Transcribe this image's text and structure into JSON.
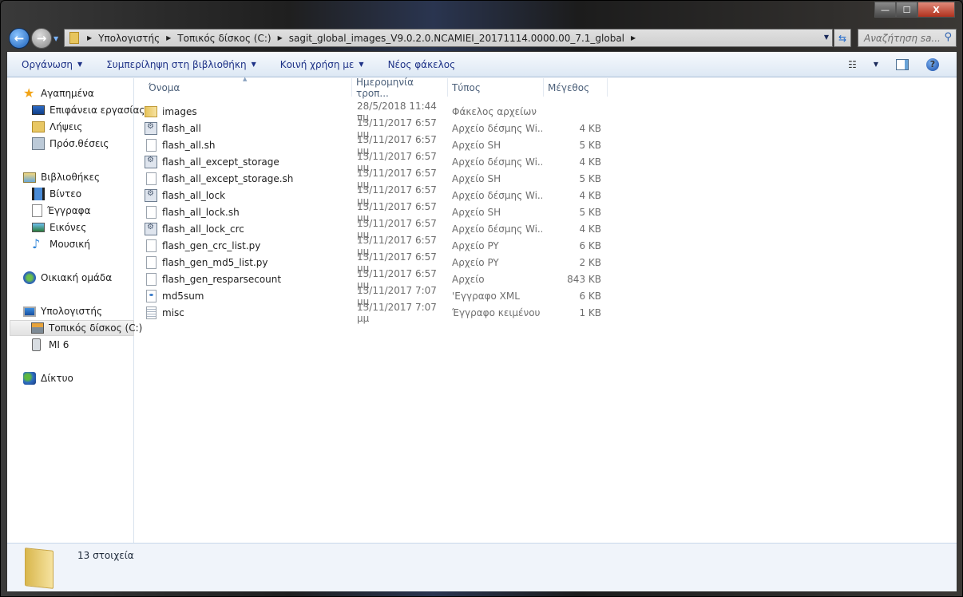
{
  "window": {
    "minimize": "—",
    "maximize": "☐",
    "close": "X"
  },
  "address": {
    "crumbs": [
      "Υπολογιστής",
      "Τοπικός δίσκος (C:)",
      "sagit_global_images_V9.0.2.0.NCAMIEI_20171114.0000.00_7.1_global"
    ]
  },
  "search": {
    "placeholder": "Αναζήτηση sa..."
  },
  "toolbar": {
    "organize": "Οργάνωση",
    "include": "Συμπερίληψη στη βιβλιοθήκη",
    "share": "Κοινή χρήση με",
    "new_folder": "Νέος φάκελος",
    "help": "?"
  },
  "sidebar": {
    "favorites": "Αγαπημένα",
    "desktop": "Επιφάνεια εργασίας",
    "downloads": "Λήψεις",
    "recent": "Πρόσ.θέσεις",
    "libraries": "Βιβλιοθήκες",
    "videos": "Βίντεο",
    "documents": "Έγγραφα",
    "pictures": "Εικόνες",
    "music": "Μουσική",
    "homegroup": "Οικιακή ομάδα",
    "computer": "Υπολογιστής",
    "local_disk": "Τοπικός δίσκος (C:)",
    "mi6": "MI 6",
    "network": "Δίκτυο"
  },
  "columns": {
    "name": "Όνομα",
    "date": "Ημερομηνία τροπ...",
    "type": "Τύπος",
    "size": "Μέγεθος"
  },
  "files": [
    {
      "name": "images",
      "date": "28/5/2018 11:44 πμ",
      "type": "Φάκελος αρχείων",
      "size": "",
      "icon": "folder"
    },
    {
      "name": "flash_all",
      "date": "13/11/2017 6:57 μμ",
      "type": "Αρχείο δέσμης Wi...",
      "size": "4 KB",
      "icon": "bat"
    },
    {
      "name": "flash_all.sh",
      "date": "13/11/2017 6:57 μμ",
      "type": "Αρχείο SH",
      "size": "5 KB",
      "icon": "file"
    },
    {
      "name": "flash_all_except_storage",
      "date": "13/11/2017 6:57 μμ",
      "type": "Αρχείο δέσμης Wi...",
      "size": "4 KB",
      "icon": "bat"
    },
    {
      "name": "flash_all_except_storage.sh",
      "date": "13/11/2017 6:57 μμ",
      "type": "Αρχείο SH",
      "size": "5 KB",
      "icon": "file"
    },
    {
      "name": "flash_all_lock",
      "date": "13/11/2017 6:57 μμ",
      "type": "Αρχείο δέσμης Wi...",
      "size": "4 KB",
      "icon": "bat"
    },
    {
      "name": "flash_all_lock.sh",
      "date": "13/11/2017 6:57 μμ",
      "type": "Αρχείο SH",
      "size": "5 KB",
      "icon": "file"
    },
    {
      "name": "flash_all_lock_crc",
      "date": "13/11/2017 6:57 μμ",
      "type": "Αρχείο δέσμης Wi...",
      "size": "4 KB",
      "icon": "bat"
    },
    {
      "name": "flash_gen_crc_list.py",
      "date": "13/11/2017 6:57 μμ",
      "type": "Αρχείο PY",
      "size": "6 KB",
      "icon": "file"
    },
    {
      "name": "flash_gen_md5_list.py",
      "date": "13/11/2017 6:57 μμ",
      "type": "Αρχείο PY",
      "size": "2 KB",
      "icon": "file"
    },
    {
      "name": "flash_gen_resparsecount",
      "date": "13/11/2017 6:57 μμ",
      "type": "Αρχείο",
      "size": "843 KB",
      "icon": "file"
    },
    {
      "name": "md5sum",
      "date": "13/11/2017 7:07 μμ",
      "type": "'Εγγραφο XML",
      "size": "6 KB",
      "icon": "xml"
    },
    {
      "name": "misc",
      "date": "13/11/2017 7:07 μμ",
      "type": "Έγγραφο κειμένου",
      "size": "1 KB",
      "icon": "txt"
    }
  ],
  "status": {
    "count": "13 στοιχεία"
  }
}
